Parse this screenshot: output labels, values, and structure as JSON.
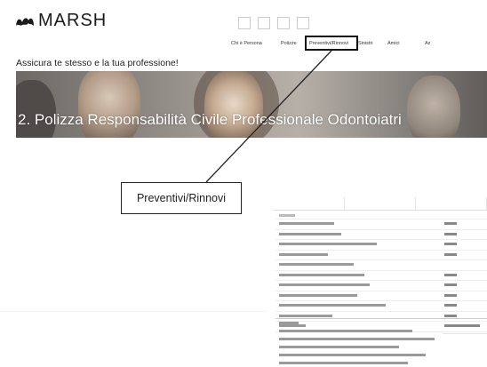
{
  "header": {
    "logo_text": "MARSH",
    "top_nav": [
      "",
      "",
      "",
      ""
    ]
  },
  "secondary_nav": [
    {
      "label": "Chi è Persona"
    },
    {
      "label": "Polizze"
    },
    {
      "label": "Preventivi/Rinnovi",
      "highlighted": true
    },
    {
      "label": "Sinistri"
    },
    {
      "label": "Amici"
    },
    {
      "label": "Az"
    }
  ],
  "tagline": "Assicura te stesso e la tua professione!",
  "hero": {
    "title": "2. Polizza Responsabilità Civile Professionale Odontoiatri"
  },
  "callout": {
    "label": "Preventivi/Rinnovi"
  },
  "colors": {
    "background": "#ffffff",
    "text": "#222222",
    "hero_overlay_text": "#ffffff",
    "highlight_border": "#111111"
  },
  "icons": {
    "logo": "marsh-logo-icon"
  }
}
